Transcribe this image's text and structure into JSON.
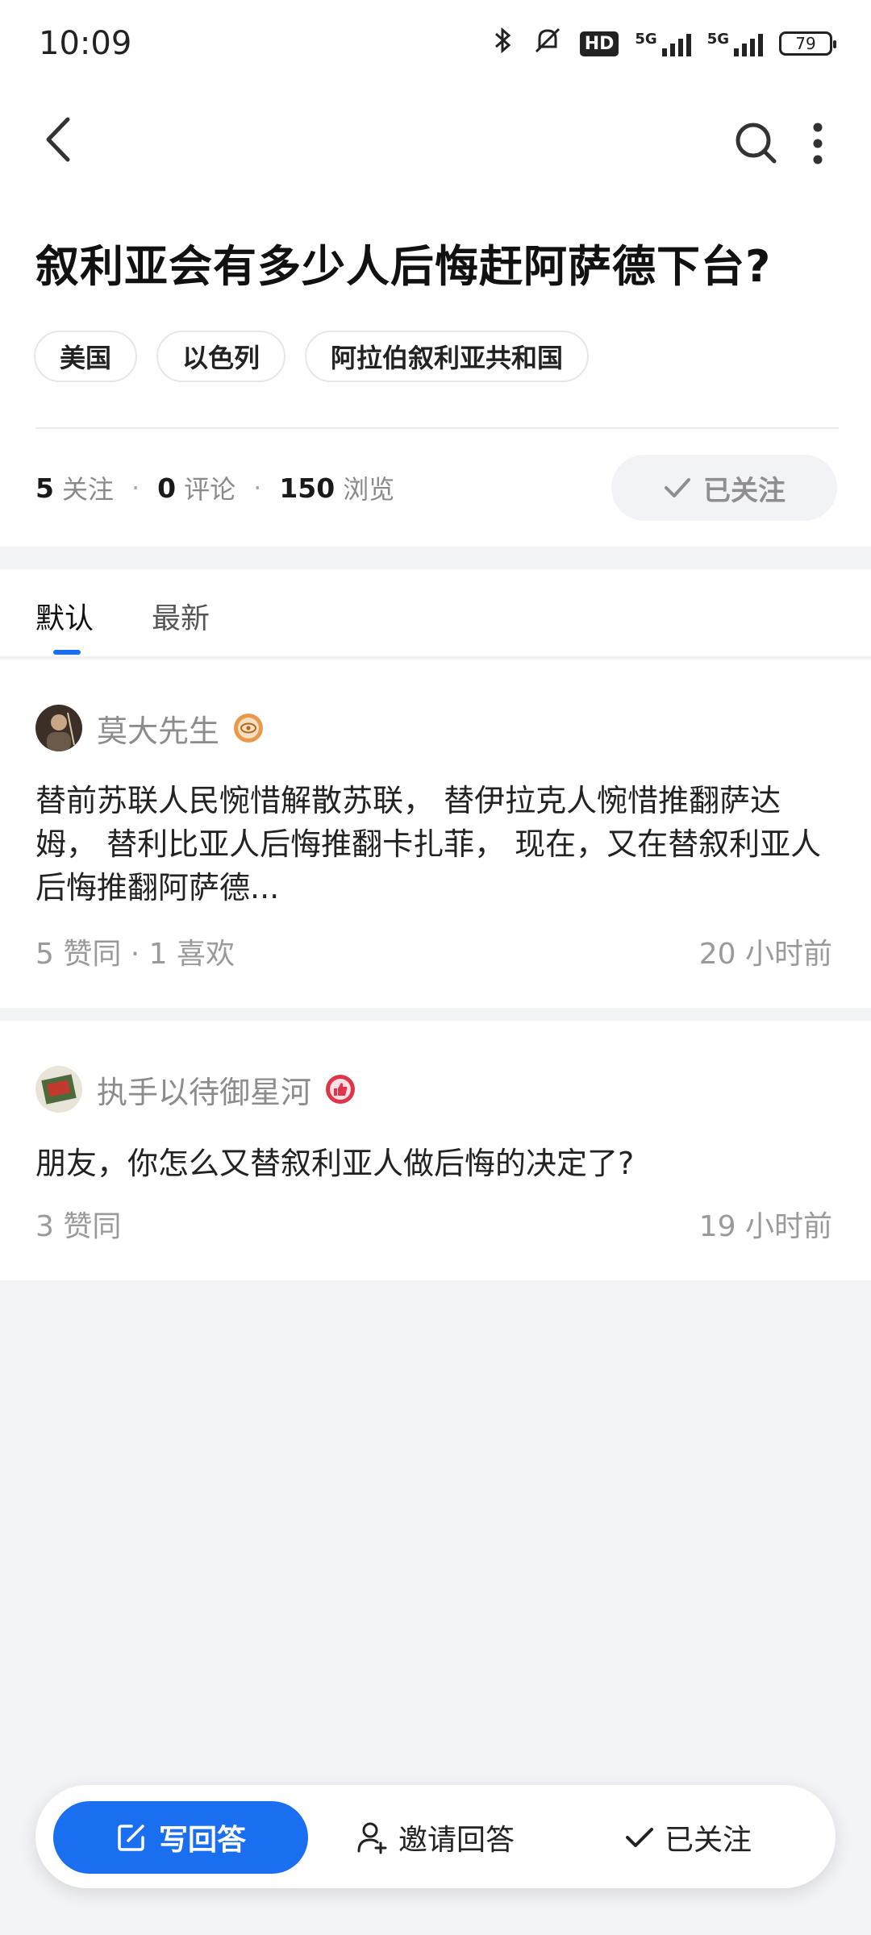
{
  "status_bar": {
    "time": "10:09",
    "hd_label": "HD",
    "network_1": "5G",
    "network_2": "5G",
    "battery": "79"
  },
  "question": {
    "title": "叙利亚会有多少人后悔赶阿萨德下台?",
    "topics": [
      "美国",
      "以色列",
      "阿拉伯叙利亚共和国"
    ],
    "stats": {
      "follows_count": "5",
      "follows_label": "关注",
      "comments_count": "0",
      "comments_label": "评论",
      "views_count": "150",
      "views_label": "浏览"
    },
    "follow_button": "已关注"
  },
  "tabs": [
    {
      "label": "默认"
    },
    {
      "label": "最新"
    }
  ],
  "answers": [
    {
      "author": "莫大先生",
      "text": "替前苏联人民惋惜解散苏联， 替伊拉克人惋惜推翻萨达姆， 替利比亚人后悔推翻卡扎菲， 现在，又在替叙利亚人后悔推翻阿萨德...",
      "meta": "5  赞同 · 1  喜欢",
      "time": "20 小时前"
    },
    {
      "author": "执手以待御星河",
      "text": "朋友，你怎么又替叙利亚人做后悔的决定了?",
      "meta": "3  赞同",
      "time": "19 小时前"
    }
  ],
  "action_bar": {
    "write": "写回答",
    "invite": "邀请回答",
    "followed": "已关注"
  },
  "colors": {
    "accent": "#1a6ef0",
    "page_bg": "#f3f4f8"
  }
}
